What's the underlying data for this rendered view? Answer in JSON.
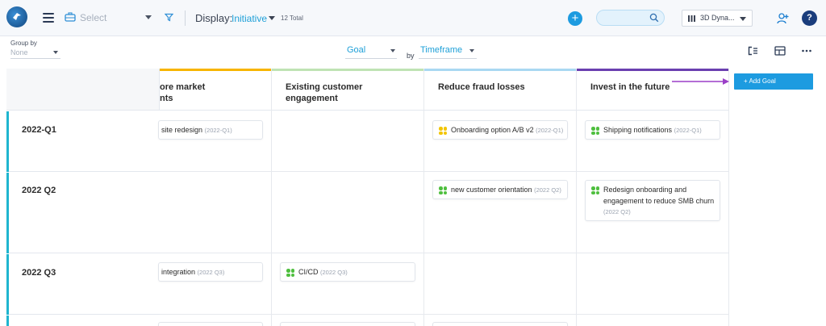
{
  "topbar": {
    "select_placeholder": "Select",
    "display_label": "Display:",
    "display_value": "Initiative",
    "total": "12 Total",
    "workspace": "3D Dyna..."
  },
  "toolbar": {
    "group_by_label": "Group by",
    "group_by_value": "None",
    "goal_select": "Goal",
    "by_label": "by",
    "timeframe_select": "Timeframe",
    "add_goal": "+ Add Goal"
  },
  "colors": {
    "accent": "#1d9be0",
    "row_accent": "#1fb5cf",
    "dot_yellow": "#f2c500",
    "dot_green": "#4fbf3f",
    "arrow": "#9b3fc7"
  },
  "goals": [
    {
      "title_line1": "ore market",
      "title_line2": "nts",
      "stripe": "#f7b500"
    },
    {
      "title_line1": "Existing customer",
      "title_line2": "engagement",
      "stripe": "#bfe3b4"
    },
    {
      "title_line1": "Reduce fraud losses",
      "title_line2": "",
      "stripe": "#a9d8f2"
    },
    {
      "title_line1": "Invest in the future",
      "title_line2": "",
      "stripe": "#6a3fb0"
    }
  ],
  "rows": [
    {
      "label": "2022-Q1"
    },
    {
      "label": "2022 Q2"
    },
    {
      "label": "2022 Q3"
    }
  ],
  "cards": [
    {
      "text": "site redesign",
      "tf": "(2022-Q1)"
    },
    {
      "text": "Onboarding option A/B v2",
      "tf": "(2022-Q1)"
    },
    {
      "text": "Shipping notifications",
      "tf": "(2022-Q1)"
    },
    {
      "text": "new customer orientation",
      "tf": "(2022 Q2)"
    },
    {
      "text1": "Redesign onboarding and",
      "text2": "engagement to reduce SMB churn",
      "tf": "(2022 Q2)"
    },
    {
      "text": "integration",
      "tf": "(2022 Q3)"
    },
    {
      "text": "CI/CD",
      "tf": "(2022 Q3)"
    }
  ]
}
